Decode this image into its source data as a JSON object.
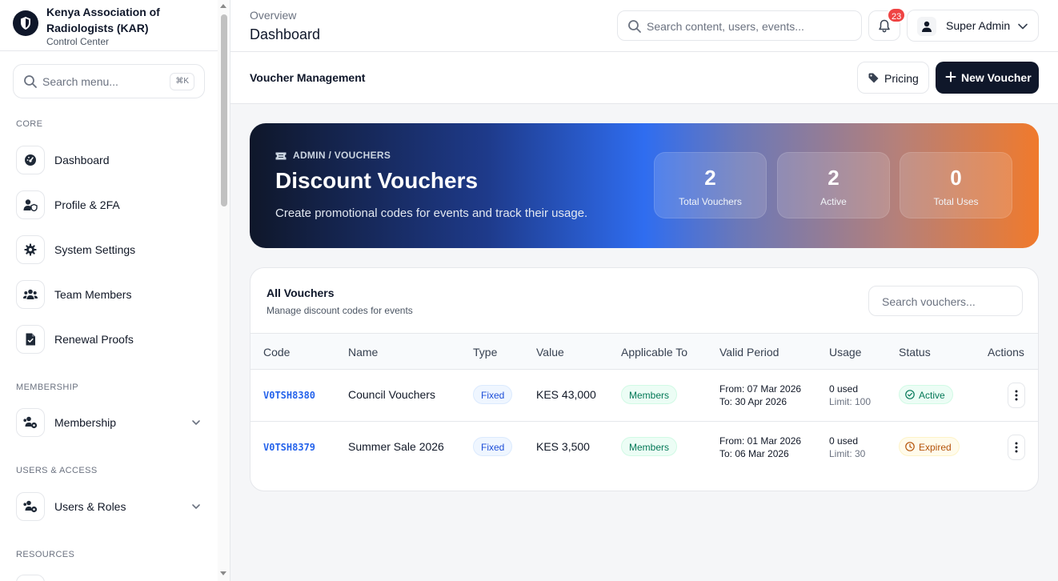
{
  "sidebar": {
    "brand_name": "Kenya Association of Radiologists (KAR)",
    "brand_sub": "Control Center",
    "search_placeholder": "Search menu...",
    "search_shortcut": "⌘K",
    "sections": {
      "core": "CORE",
      "membership": "MEMBERSHIP",
      "users_access": "USERS & ACCESS",
      "resources": "RESOURCES"
    },
    "items": [
      {
        "label": "Dashboard",
        "icon": "gauge-icon"
      },
      {
        "label": "Profile & 2FA",
        "icon": "user-shield-icon"
      },
      {
        "label": "System Settings",
        "icon": "gear-icon"
      },
      {
        "label": "Team Members",
        "icon": "users-icon"
      },
      {
        "label": "Renewal Proofs",
        "icon": "file-icon"
      },
      {
        "label": "Membership",
        "icon": "users-gear-icon"
      },
      {
        "label": "Users & Roles",
        "icon": "users-gear-icon"
      }
    ]
  },
  "topbar": {
    "crumb": "Overview",
    "title": "Dashboard",
    "search_placeholder": "Search content, users, events...",
    "notification_count": "23",
    "user_name": "Super Admin"
  },
  "subheader": {
    "title": "Voucher Management",
    "pricing_label": "Pricing",
    "new_voucher_label": "New Voucher"
  },
  "hero": {
    "crumb": "ADMIN / VOUCHERS",
    "title": "Discount Vouchers",
    "description": "Create promotional codes for events and track their usage.",
    "stats": [
      {
        "value": "2",
        "label": "Total Vouchers"
      },
      {
        "value": "2",
        "label": "Active"
      },
      {
        "value": "0",
        "label": "Total Uses"
      }
    ]
  },
  "vouchers": {
    "title": "All Vouchers",
    "subtitle": "Manage discount codes for events",
    "search_placeholder": "Search vouchers...",
    "columns": [
      "Code",
      "Name",
      "Type",
      "Value",
      "Applicable To",
      "Valid Period",
      "Usage",
      "Status",
      "Actions"
    ],
    "rows": [
      {
        "code": "V0TSH8380",
        "name": "Council Vouchers",
        "type": "Fixed",
        "value": "KES 43,000",
        "applicable": "Members",
        "from": "From: 07 Mar 2026",
        "to": "To: 30 Apr 2026",
        "used": "0 used",
        "limit": "Limit: 100",
        "status": "Active"
      },
      {
        "code": "V0TSH8379",
        "name": "Summer Sale 2026",
        "type": "Fixed",
        "value": "KES 3,500",
        "applicable": "Members",
        "from": "From: 01 Mar 2026",
        "to": "To: 06 Mar 2026",
        "used": "0 used",
        "limit": "Limit: 30",
        "status": "Expired"
      }
    ]
  },
  "colors": {
    "primary": "#0f172a",
    "link": "#2563eb",
    "badge": "#ef4444",
    "success": "#047857",
    "warning": "#b45309",
    "hero_end": "#f07a2c"
  }
}
